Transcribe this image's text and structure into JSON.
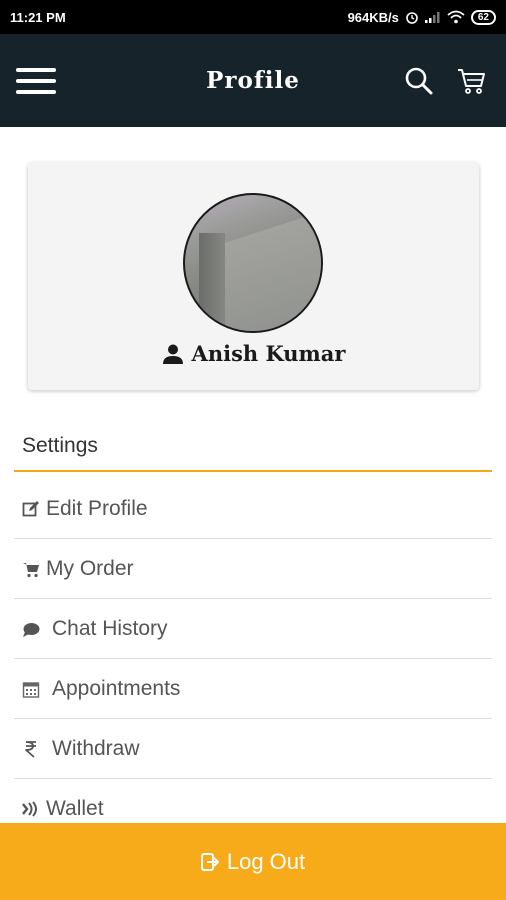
{
  "status_bar": {
    "time": "11:21 PM",
    "speed": "964KB/s",
    "battery": "62"
  },
  "app_bar": {
    "title": "Profile"
  },
  "profile": {
    "name": "Anish Kumar"
  },
  "settings": {
    "heading": "Settings",
    "items": [
      {
        "label": "Edit Profile",
        "icon": "edit-icon"
      },
      {
        "label": "My Order",
        "icon": "cart-icon"
      },
      {
        "label": "Chat History",
        "icon": "chat-bubble-icon"
      },
      {
        "label": "Appointments",
        "icon": "calendar-icon"
      },
      {
        "label": "Withdraw",
        "icon": "rupee-icon"
      },
      {
        "label": "Wallet",
        "icon": "wallet-icon"
      }
    ]
  },
  "logout": {
    "label": "Log Out"
  },
  "colors": {
    "app_bar": "#16232a",
    "accent": "#f7ab1b",
    "status_bar": "#000000"
  }
}
